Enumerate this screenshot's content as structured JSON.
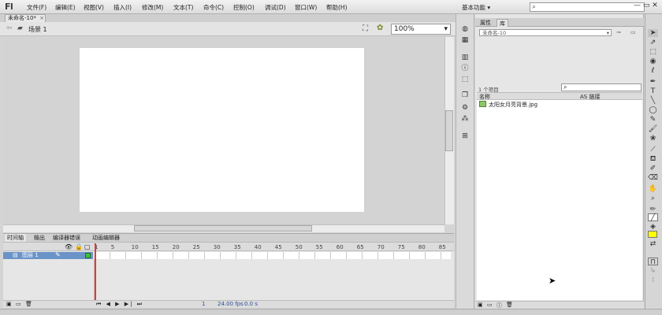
{
  "app": {
    "logo": "Fl",
    "menus": [
      "文件(F)",
      "编辑(E)",
      "视图(V)",
      "插入(I)",
      "修改(M)",
      "文本(T)",
      "命令(C)",
      "控制(O)",
      "调试(D)",
      "窗口(W)",
      "帮助(H)"
    ],
    "workspace": "基本功能 ▾",
    "search_icon": "⌕",
    "window_controls": "— ▭ ✕"
  },
  "document": {
    "tab_title": "未命名-10*",
    "tab_close": "×",
    "scene_name": "场景 1",
    "zoom": "100%",
    "zoom_arrow": "▾"
  },
  "timeline": {
    "tabs": [
      "时间轴",
      "输出",
      "编译器错误",
      "动画编辑器"
    ],
    "ruler": [
      "1",
      "5",
      "10",
      "15",
      "20",
      "25",
      "30",
      "35",
      "40",
      "45",
      "50",
      "55",
      "60",
      "65",
      "70",
      "75",
      "80",
      "85"
    ],
    "layer_name": "图层 1",
    "footer": {
      "frame": "1",
      "fps": "24.00 fps",
      "time": "0.0 s"
    },
    "controls": "⏮ ◀ ▶ ▶| ⏭"
  },
  "library": {
    "tabs": [
      "属性",
      "库"
    ],
    "doc_select": "未命名-10",
    "item_count": "1 个项目",
    "columns": {
      "name": "名称",
      "linkage": "AS 链接"
    },
    "items": [
      {
        "name": "太阳女月亮背景.jpg"
      }
    ]
  },
  "colors": {
    "layer_selected": "#6a93c8",
    "fill_color": "#ffff00",
    "playhead": "#e03a3a"
  }
}
